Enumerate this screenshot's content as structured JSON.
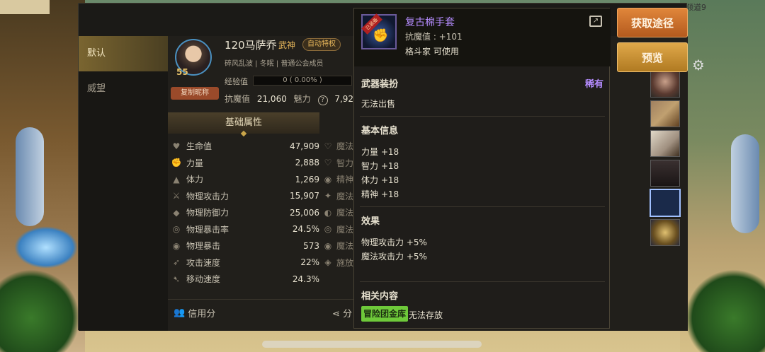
{
  "background": {
    "channel_text": "频道9"
  },
  "sidebar": {
    "items": [
      {
        "label": "默认",
        "active": true
      },
      {
        "label": "威望",
        "active": false
      }
    ]
  },
  "profile": {
    "level": "55",
    "copy_nick_label": "复制昵称",
    "name": "120马萨乔",
    "class": "武神",
    "auto_feature_label": "自动特权",
    "tags": "碎风乱波 | 冬眠 | 普通公会成员",
    "exp_label": "经验值",
    "exp_value": "0 ( 0.00% )",
    "resist_label": "抗魔值",
    "resist_value": "21,060",
    "charm_label": "魅力",
    "charm_value": "7,92",
    "tab_label": "基础属性"
  },
  "stats": [
    {
      "icon": "heart-icon",
      "label": "生命值",
      "value": "47,909"
    },
    {
      "icon": "fist-icon",
      "label": "力量",
      "value": "2,888"
    },
    {
      "icon": "body-icon",
      "label": "体力",
      "value": "1,269"
    },
    {
      "icon": "sword-icon",
      "label": "物理攻击力",
      "value": "15,907"
    },
    {
      "icon": "shield-icon",
      "label": "物理防御力",
      "value": "25,006"
    },
    {
      "icon": "crit-icon",
      "label": "物理暴击率",
      "value": "24.5%"
    },
    {
      "icon": "crit-dmg-icon",
      "label": "物理暴击",
      "value": "573"
    },
    {
      "icon": "attack-speed-icon",
      "label": "攻击速度",
      "value": "22%"
    },
    {
      "icon": "move-speed-icon",
      "label": "移动速度",
      "value": "24.3%"
    }
  ],
  "stats_right_partial": [
    {
      "icon": "heart-outline-icon",
      "label": "魔法"
    },
    {
      "icon": "wisdom-icon",
      "label": "智力"
    },
    {
      "icon": "spirit-icon",
      "label": "精神"
    },
    {
      "icon": "magic-atk-icon",
      "label": "魔法"
    },
    {
      "icon": "magic-def-icon",
      "label": "魔法"
    },
    {
      "icon": "magic-crit-icon",
      "label": "魔法"
    },
    {
      "icon": "magic-crit-dmg-icon",
      "label": "魔法"
    },
    {
      "icon": "cast-speed-icon",
      "label": "施放"
    }
  ],
  "footer": {
    "credit_label": "信用分",
    "share_label": "分"
  },
  "buttons": {
    "acquire": "获取途径",
    "preview": "预览"
  },
  "tooltip": {
    "item_name": "复古棉手套",
    "ribbon_text": "已装备",
    "resist": "抗魔值 : +101",
    "usable": "格斗家 可使用",
    "section_weapon_dressup": "武器装扮",
    "rarity": "稀有",
    "no_sale": "无法出售",
    "section_basic": "基本信息",
    "basic_stats": [
      "力量 +18",
      "智力 +18",
      "体力 +18",
      "精神 +18"
    ],
    "section_effect": "效果",
    "effects": [
      "物理攻击力 +5%",
      "魔法攻击力 +5%"
    ],
    "section_related": "相关内容",
    "related_badge": "冒险团金库",
    "related_text": "无法存放"
  },
  "colors": {
    "rarity_purple": "#b58cff",
    "acquire_btn": "#d0722c",
    "preview_btn": "#d09a3a",
    "badge_green": "#6ec93a"
  }
}
